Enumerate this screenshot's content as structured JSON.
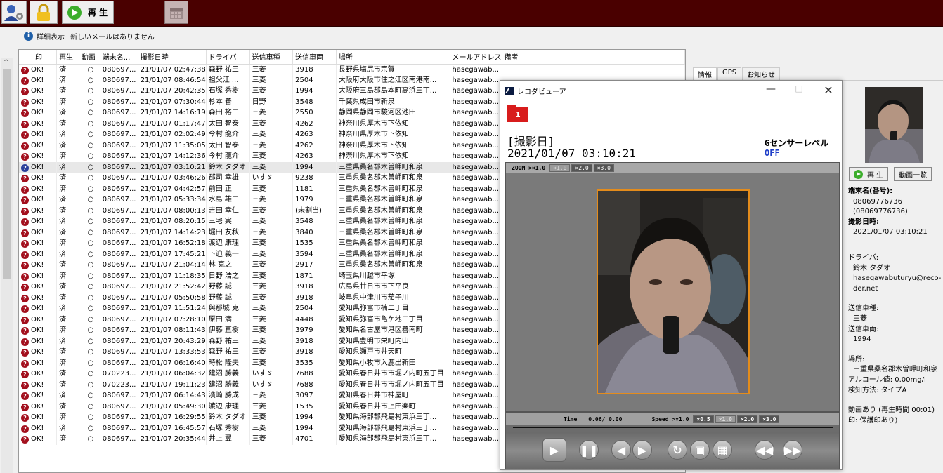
{
  "toolbar": {
    "play_label": "再 生"
  },
  "subbar": {
    "detail_label": "詳細表示",
    "mail_status": "新しいメールはありません"
  },
  "grid": {
    "headers": [
      "印",
      "再生",
      "動画",
      "端末名...",
      "撮影日時",
      "ドライバ",
      "送信車種",
      "送信車両",
      "場所",
      "メールアドレス",
      "備考"
    ],
    "rows": [
      [
        "OK!",
        "済",
        "○",
        "080697...",
        "21/01/07 02:47:38",
        "森野 祐三",
        "三菱",
        "3918",
        "長野県塩尻市宗賀",
        "hasegawab..."
      ],
      [
        "OK!",
        "済",
        "○",
        "080697...",
        "21/01/07 08:46:54",
        "祖父江 ...",
        "三菱",
        "2504",
        "大阪府大阪市住之江区南港南...",
        "hasegawab..."
      ],
      [
        "OK!",
        "済",
        "○",
        "080697...",
        "21/01/07 20:42:35",
        "石塚 秀樹",
        "三菱",
        "1994",
        "大阪府三島郡島本町高浜三丁...",
        "hasegawab..."
      ],
      [
        "OK!",
        "済",
        "○",
        "080697...",
        "21/01/07 07:30:44",
        "杉本 善",
        "日野",
        "3548",
        "千葉県成田市新泉",
        "hasegawab..."
      ],
      [
        "OK!",
        "済",
        "○",
        "080697...",
        "21/01/07 14:16:19",
        "森田 裕二",
        "三菱",
        "2550",
        "静岡県静岡市駿河区池田",
        "hasegawab..."
      ],
      [
        "OK!",
        "済",
        "○",
        "080697...",
        "21/01/07 01:17:47",
        "太田 智泰",
        "三菱",
        "4262",
        "神奈川県厚木市下依知",
        "hasegawab..."
      ],
      [
        "OK!",
        "済",
        "○",
        "080697...",
        "21/01/07 02:02:49",
        "今村 龍介",
        "三菱",
        "4263",
        "神奈川県厚木市下依知",
        "hasegawab..."
      ],
      [
        "OK!",
        "済",
        "○",
        "080697...",
        "21/01/07 11:35:05",
        "太田 智泰",
        "三菱",
        "4262",
        "神奈川県厚木市下依知",
        "hasegawab..."
      ],
      [
        "OK!",
        "済",
        "○",
        "080697...",
        "21/01/07 14:12:36",
        "今村 龍介",
        "三菱",
        "4263",
        "神奈川県厚木市下依知",
        "hasegawab..."
      ],
      [
        "OK!",
        "済",
        "○",
        "080697...",
        "21/01/07 03:10:21",
        "鈴木 タダオ",
        "三菱",
        "1994",
        "三重県桑名郡木曽岬町和泉",
        "hasegawab..."
      ],
      [
        "OK!",
        "済",
        "○",
        "080697...",
        "21/01/07 03:46:26",
        "郡司 幸雄",
        "いすゞ",
        "9238",
        "三重県桑名郡木曽岬町和泉",
        "hasegawab..."
      ],
      [
        "OK!",
        "済",
        "○",
        "080697...",
        "21/01/07 04:42:57",
        "前田 正",
        "三菱",
        "1181",
        "三重県桑名郡木曽岬町和泉",
        "hasegawab..."
      ],
      [
        "OK!",
        "済",
        "○",
        "080697...",
        "21/01/07 05:33:34",
        "水島 雄二",
        "三菱",
        "1979",
        "三重県桑名郡木曽岬町和泉",
        "hasegawab..."
      ],
      [
        "OK!",
        "済",
        "○",
        "080697...",
        "21/01/07 08:00:13",
        "吉田 幸仁",
        "三菱",
        "(未割当)",
        "三重県桑名郡木曽岬町和泉",
        "hasegawab..."
      ],
      [
        "OK!",
        "済",
        "○",
        "080697...",
        "21/01/07 08:20:15",
        "三宅 実",
        "三菱",
        "3548",
        "三重県桑名郡木曽岬町和泉",
        "hasegawab..."
      ],
      [
        "OK!",
        "済",
        "○",
        "080697...",
        "21/01/07 14:14:23",
        "堀田 友秋",
        "三菱",
        "3840",
        "三重県桑名郡木曽岬町和泉",
        "hasegawab..."
      ],
      [
        "OK!",
        "済",
        "○",
        "080697...",
        "21/01/07 16:52:18",
        "渡辺 康理",
        "三菱",
        "1535",
        "三重県桑名郡木曽岬町和泉",
        "hasegawab..."
      ],
      [
        "OK!",
        "済",
        "○",
        "080697...",
        "21/01/07 17:45:21",
        "下迫 義一",
        "三菱",
        "3594",
        "三重県桑名郡木曽岬町和泉",
        "hasegawab..."
      ],
      [
        "OK!",
        "済",
        "○",
        "080697...",
        "21/01/07 21:04:14",
        "林 克之",
        "三菱",
        "2917",
        "三重県桑名郡木曽岬町和泉",
        "hasegawab..."
      ],
      [
        "OK!",
        "済",
        "○",
        "080697...",
        "21/01/07 11:18:35",
        "日野 浩之",
        "三菱",
        "1871",
        "埼玉県川越市平塚",
        "hasegawab..."
      ],
      [
        "OK!",
        "済",
        "○",
        "080697...",
        "21/01/07 21:52:42",
        "野藤 誠",
        "三菱",
        "3918",
        "広島県廿日市市下平良",
        "hasegawab..."
      ],
      [
        "OK!",
        "済",
        "○",
        "080697...",
        "21/01/07 05:50:58",
        "野藤 誠",
        "三菱",
        "3918",
        "岐阜県中津川市茄子川",
        "hasegawab..."
      ],
      [
        "OK!",
        "済",
        "○",
        "080697...",
        "21/01/07 11:51:24",
        "與那城 克",
        "三菱",
        "2504",
        "愛知県弥富市楠二丁目",
        "hasegawab..."
      ],
      [
        "OK!",
        "済",
        "○",
        "080697...",
        "21/01/07 07:28:10",
        "原田 満",
        "三菱",
        "4448",
        "愛知県弥富市亀ケ地二丁目",
        "hasegawab..."
      ],
      [
        "OK!",
        "済",
        "○",
        "080697...",
        "21/01/07 08:11:43",
        "伊藤 直樹",
        "三菱",
        "3979",
        "愛知県名古屋市港区善南町",
        "hasegawab..."
      ],
      [
        "OK!",
        "済",
        "○",
        "080697...",
        "21/01/07 20:43:29",
        "森野 祐三",
        "三菱",
        "3918",
        "愛知県豊明市栄町内山",
        "hasegawab..."
      ],
      [
        "OK!",
        "済",
        "○",
        "080697...",
        "21/01/07 13:33:53",
        "森野 祐三",
        "三菱",
        "3918",
        "愛知県瀬戸市井天町",
        "hasegawab..."
      ],
      [
        "OK!",
        "済",
        "○",
        "080697...",
        "21/01/07 06:16:40",
        "時松 隆夫",
        "三菱",
        "3535",
        "愛知県小牧市入鹿出新田",
        "hasegawab..."
      ],
      [
        "OK!",
        "済",
        "○",
        "070223...",
        "21/01/07 06:04:32",
        "建沼 勝義",
        "いすゞ",
        "7688",
        "愛知県春日井市市堀ノ内町五丁目",
        "hasegawab..."
      ],
      [
        "OK!",
        "済",
        "○",
        "070223...",
        "21/01/07 19:11:23",
        "建沼 勝義",
        "いすゞ",
        "7688",
        "愛知県春日井市市堀ノ内町五丁目",
        "hasegawab..."
      ],
      [
        "OK!",
        "済",
        "○",
        "080697...",
        "21/01/07 06:14:43",
        "濱崎 勝成",
        "三菱",
        "3097",
        "愛知県春日井市神屋町",
        "hasegawab..."
      ],
      [
        "OK!",
        "済",
        "○",
        "080697...",
        "21/01/07 05:49:30",
        "渡辺 康理",
        "三菱",
        "1535",
        "愛知県春日井市上田楽町",
        "hasegawab..."
      ],
      [
        "OK!",
        "済",
        "○",
        "080697...",
        "21/01/07 16:29:55",
        "鈴木 タダオ",
        "三菱",
        "1994",
        "愛知県海部郡飛島村東浜三丁...",
        "hasegawab..."
      ],
      [
        "OK!",
        "済",
        "○",
        "080697...",
        "21/01/07 16:45:57",
        "石塚 秀樹",
        "三菱",
        "1994",
        "愛知県海部郡飛島村東浜三丁...",
        "hasegawab..."
      ],
      [
        "OK!",
        "済",
        "○",
        "080697...",
        "21/01/07 20:35:44",
        "井上 翼",
        "三菱",
        "4701",
        "愛知県海部郡飛島村東浜三丁...",
        "hasegawab..."
      ]
    ]
  },
  "right": {
    "tabs": [
      "情報",
      "GPS",
      "お知らせ"
    ],
    "play_label": "再 生",
    "video_list_label": "動画一覧",
    "terminal_label": "端末名(番号):",
    "terminal_value": "08069776736",
    "terminal_number": "(08069776736)",
    "shot_label": "撮影日時:",
    "shot_value": "2021/01/07 03:10:21",
    "driver_label": "ドライバ:",
    "driver_value": "鈴木 タダオ",
    "driver_email": "hasegawabuturyu@reco-der.net",
    "vehicle_type_label": "送信車種:",
    "vehicle_type_value": "三菱",
    "vehicle_no_label": "送信車両:",
    "vehicle_no_value": "1994",
    "place_label": "場所:",
    "place_value": "三重県桑名郡木曽岬町和泉",
    "alcohol": "アルコール値: 0.00mg/l",
    "detect": "検知方法: タイプA",
    "video_info": "動画あり (再生時間 00:01)",
    "mark_info": "印: 保護印あり)"
  },
  "viewer": {
    "title": "レコダビューア",
    "folder_number": "1",
    "shot_heading": "[撮影日]",
    "shot_datetime": "2021/01/07 03:10:21",
    "gsensor_label": "Gセンサーレベル",
    "gsensor_value": "OFF",
    "zoom_label": "ZOOM >×1.0",
    "zoom_options": [
      "×1.0",
      "×2.0",
      "×3.0"
    ],
    "time_label": "Time",
    "time_value": "0.06/ 0.00",
    "speed_label": "Speed >×1.0",
    "speed_options": [
      "×0.5",
      "×1.0",
      "×2.0",
      "×3.0"
    ]
  }
}
